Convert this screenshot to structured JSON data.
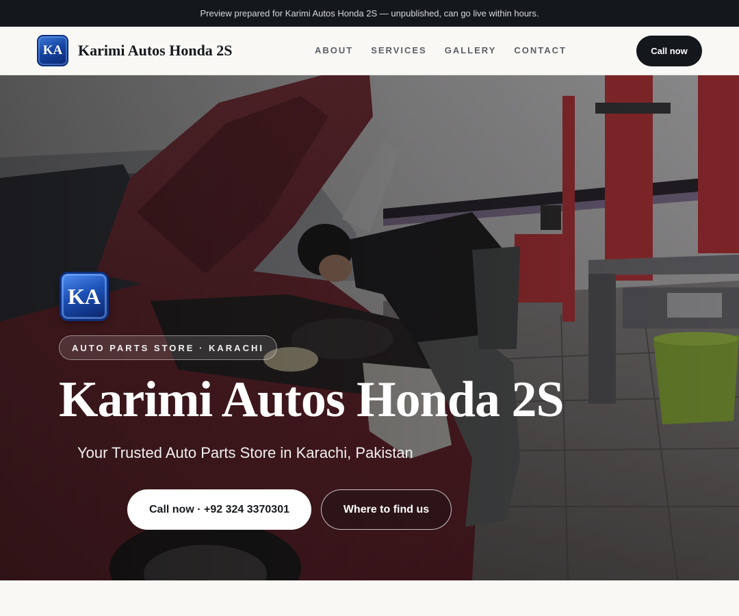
{
  "topbar": {
    "notice": "Preview prepared for Karimi Autos Honda 2S — unpublished, can go live within hours."
  },
  "header": {
    "logo_text": "KA",
    "brand_name": "Karimi Autos Honda 2S",
    "nav": [
      "ABOUT",
      "SERVICES",
      "GALLERY",
      "CONTACT"
    ],
    "call_label": "Call now"
  },
  "hero": {
    "logo_text": "KA",
    "badge": "AUTO PARTS STORE · KARACHI",
    "title": "Karimi Autos Honda 2S",
    "subtitle": "Your Trusted Auto Parts Store in Karachi, Pakistan",
    "primary_cta": "Call now · +92 324 3370301",
    "secondary_cta": "Where to find us"
  },
  "colors": {
    "dark": "#14171c",
    "page_bg": "#f9f8f5",
    "logo_blue": "#1746a4",
    "car_red": "#7a2a33",
    "lift_red": "#c4363c"
  }
}
